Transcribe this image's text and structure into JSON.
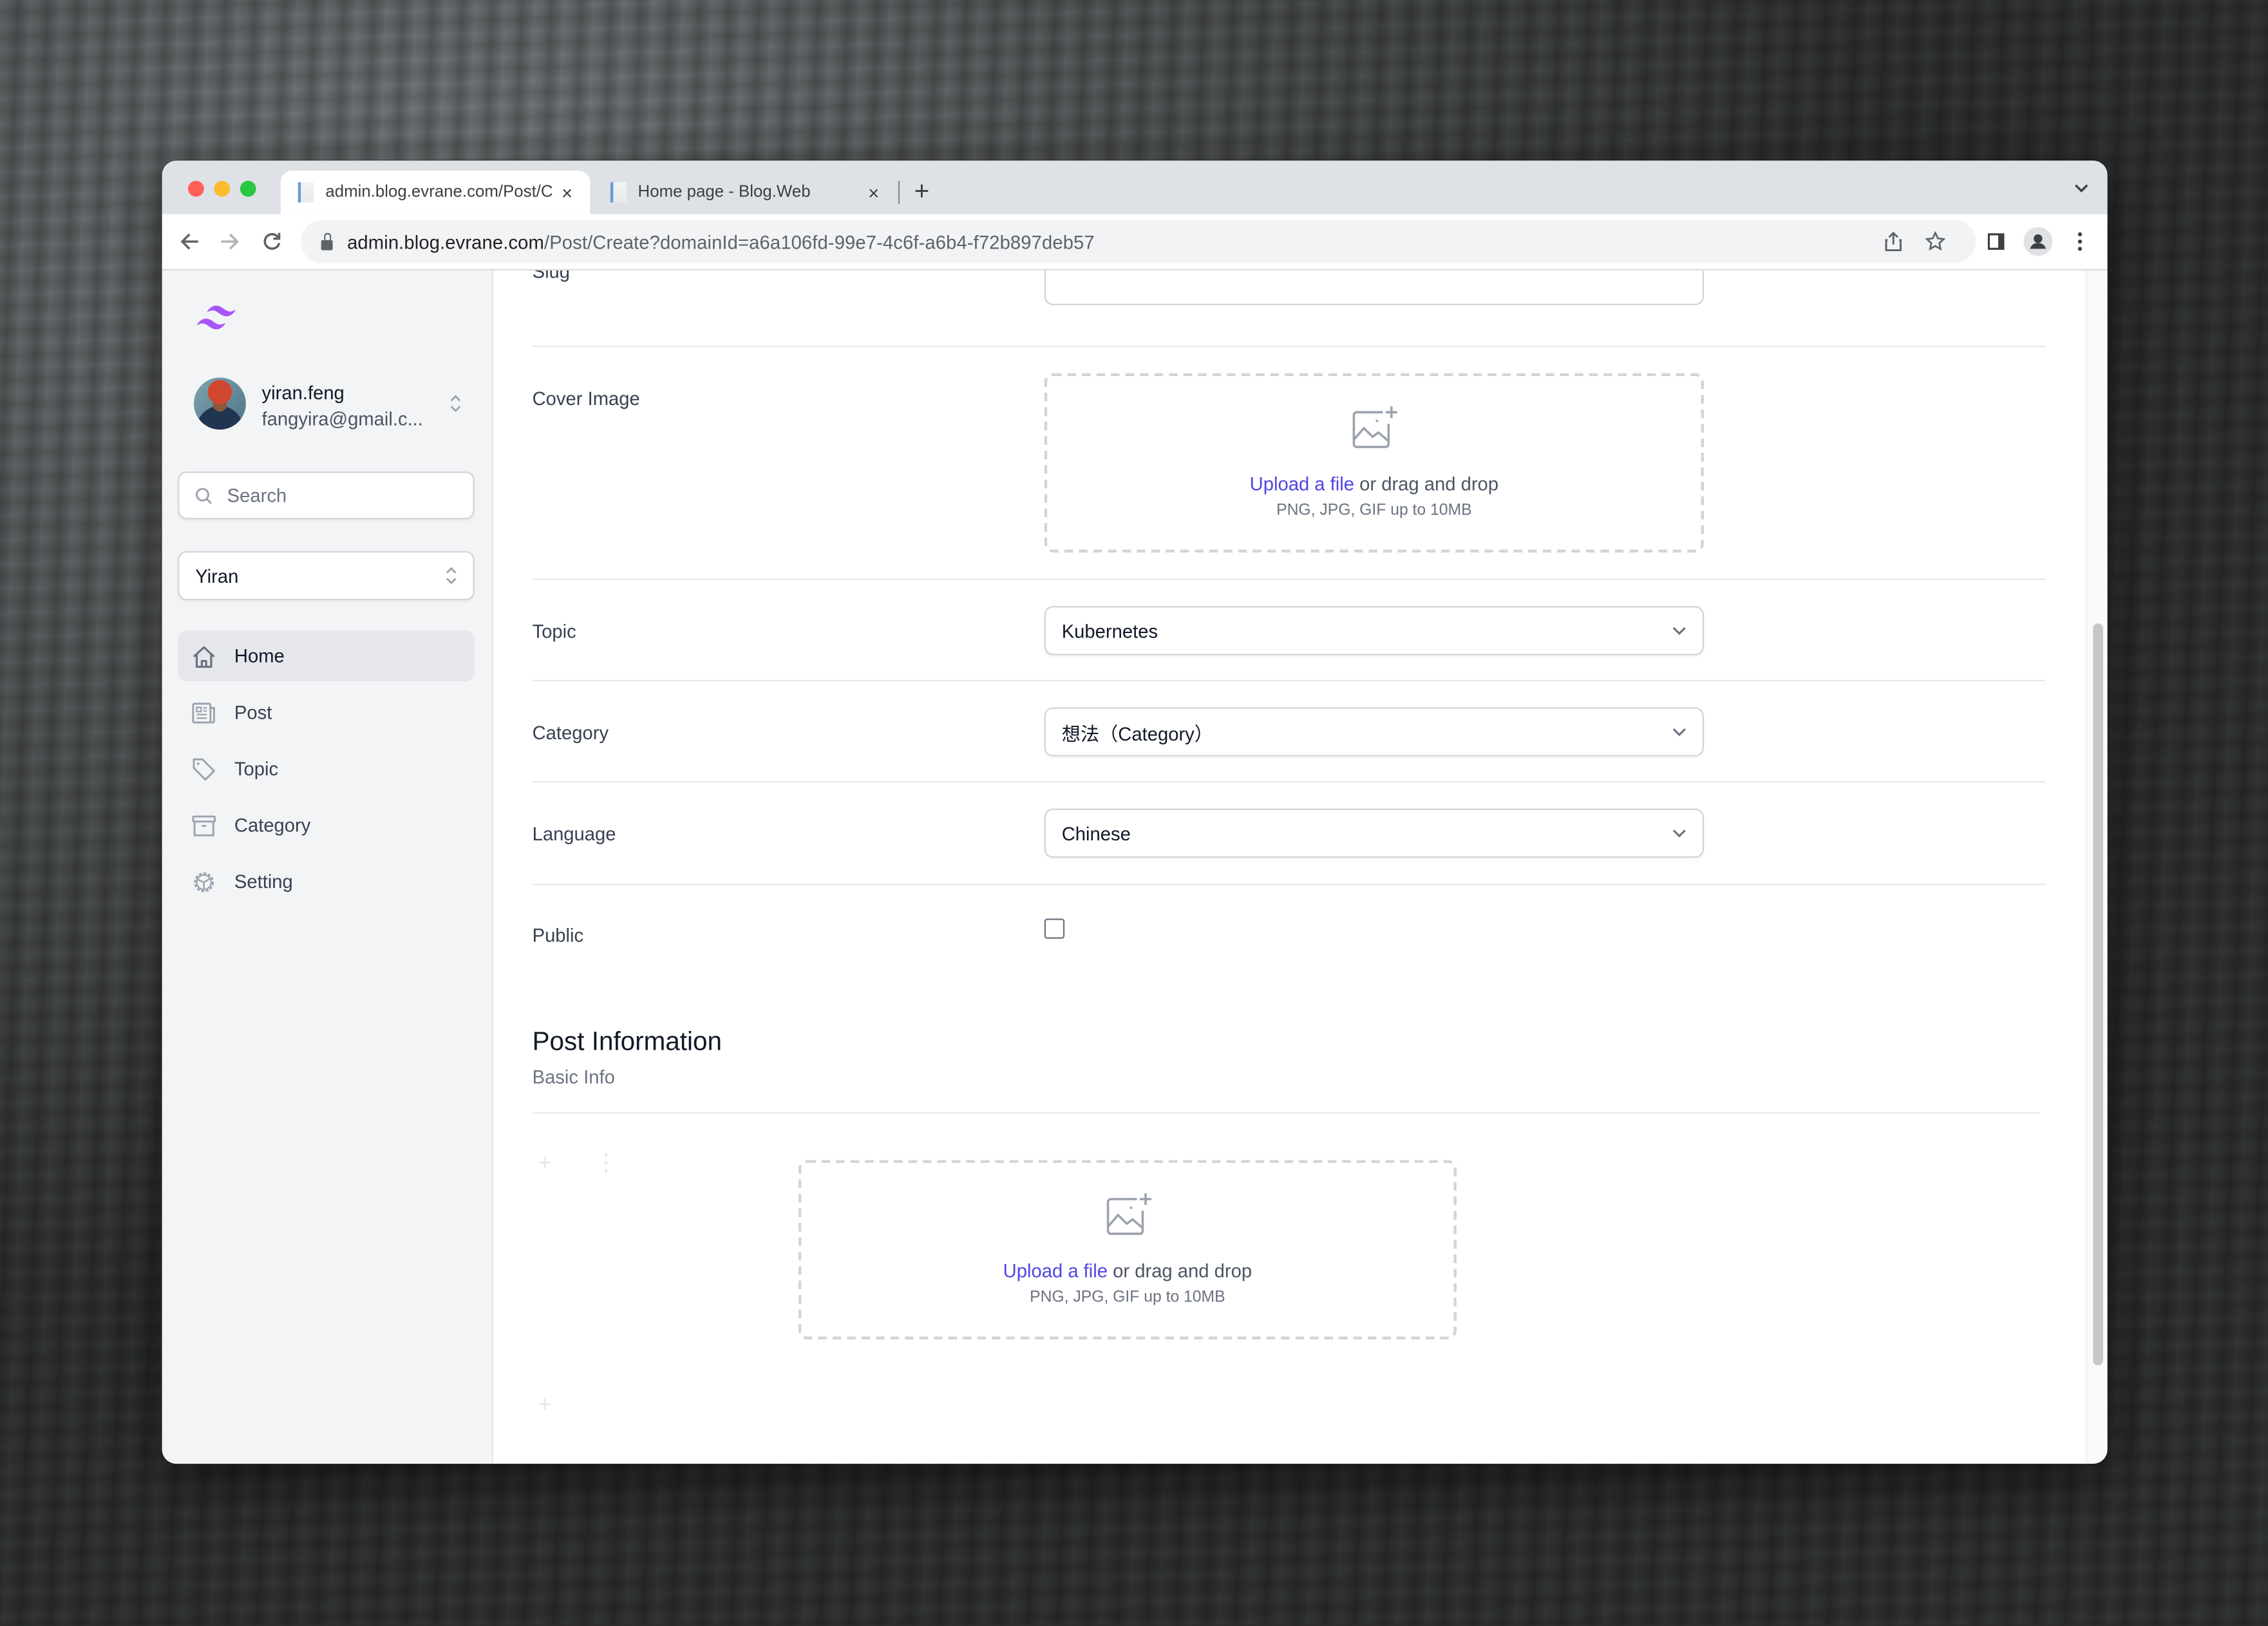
{
  "browser": {
    "tabs": [
      {
        "title": "admin.blog.evrane.com/Post/C",
        "active": true
      },
      {
        "title": "Home page - Blog.Web",
        "active": false
      }
    ],
    "close_glyph": "×",
    "new_tab_glyph": "+",
    "url_host": "admin.blog.evrane.com",
    "url_path": "/Post/Create?domainId=a6a106fd-99e7-4c6f-a6b4-f72b897deb57",
    "icons": [
      "back-icon",
      "forward-icon",
      "reload-icon",
      "lock-icon",
      "share-icon",
      "bookmark-star-icon",
      "side-panel-icon",
      "profile-icon",
      "more-menu-icon",
      "tab-search-icon"
    ]
  },
  "sidebar": {
    "brand_color": "#a855f7",
    "user": {
      "name": "yiran.feng",
      "email": "fangyira@gmail.c..."
    },
    "search": {
      "placeholder": "Search",
      "value": ""
    },
    "domain_select": {
      "value": "Yiran"
    },
    "items": [
      {
        "label": "Home",
        "icon": "home-icon",
        "active": true
      },
      {
        "label": "Post",
        "icon": "newspaper-icon",
        "active": false
      },
      {
        "label": "Topic",
        "icon": "tag-icon",
        "active": false
      },
      {
        "label": "Category",
        "icon": "archive-box-icon",
        "active": false
      },
      {
        "label": "Setting",
        "icon": "cog-icon",
        "active": false
      }
    ]
  },
  "form": {
    "slug_label_partial": "Slug",
    "cover_image": {
      "label": "Cover Image",
      "upload_link": "Upload a file",
      "upload_rest": " or drag and drop",
      "hint": "PNG, JPG, GIF up to 10MB"
    },
    "topic": {
      "label": "Topic",
      "value": "Kubernetes"
    },
    "category": {
      "label": "Category",
      "value": "想法（Category）"
    },
    "language": {
      "label": "Language",
      "value": "Chinese"
    },
    "public": {
      "label": "Public",
      "checked": false
    }
  },
  "post_information": {
    "title": "Post Information",
    "subtitle": "Basic Info",
    "block_upload": {
      "upload_link": "Upload a file",
      "upload_rest": " or drag and drop",
      "hint": "PNG, JPG, GIF up to 10MB"
    },
    "add_block_glyph": "+",
    "drag_handle_glyph": "⋮"
  },
  "colors": {
    "link": "#4f46e5",
    "sidebar_bg": "#f3f4f6",
    "active_nav_bg": "#e5e7eb"
  }
}
